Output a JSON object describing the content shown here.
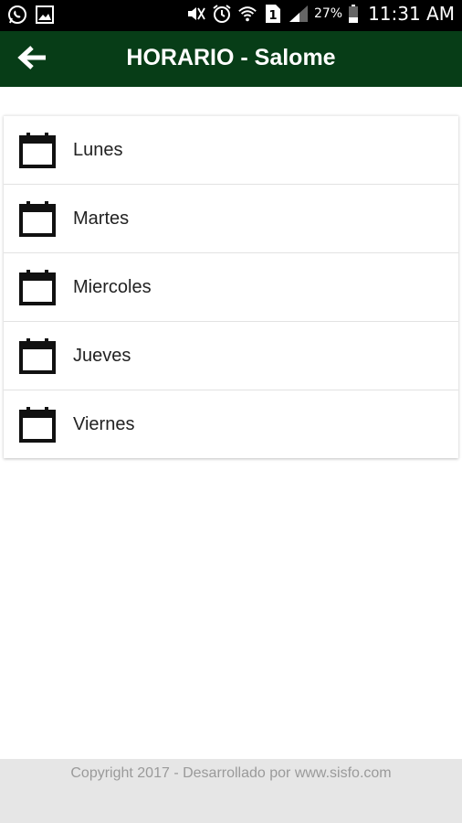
{
  "status_bar": {
    "battery_percent": "27%",
    "time": "11:31 AM",
    "sim_slot": "1"
  },
  "app_bar": {
    "title": "HORARIO - Salome",
    "background": "#073d17"
  },
  "days": [
    {
      "label": "Lunes"
    },
    {
      "label": "Martes"
    },
    {
      "label": "Miercoles"
    },
    {
      "label": "Jueves"
    },
    {
      "label": "Viernes"
    }
  ],
  "footer": {
    "text": "Copyright 2017 - Desarrollado por www.sisfo.com"
  },
  "icons": {
    "row_icon": "calendar-icon",
    "back": "arrow-left-icon"
  }
}
